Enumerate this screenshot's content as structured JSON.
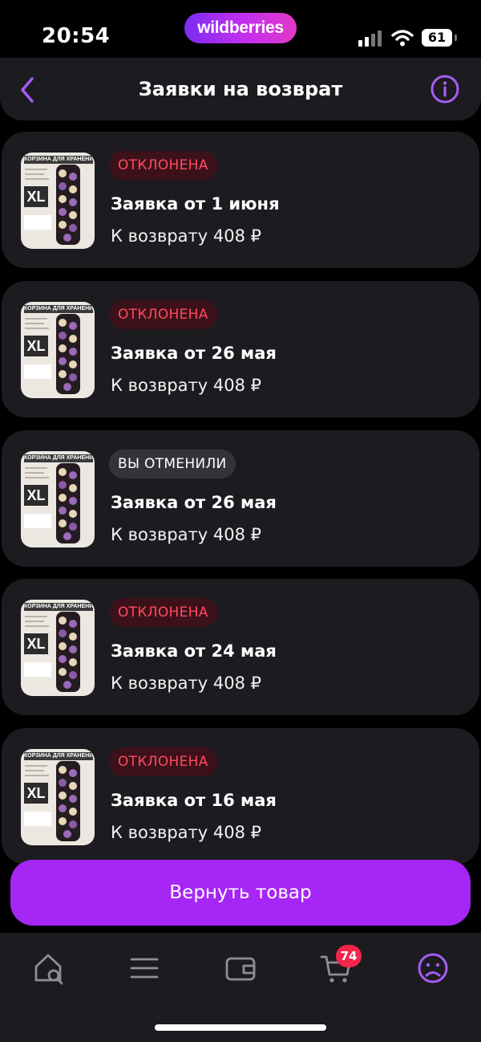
{
  "status_bar": {
    "time": "20:54",
    "brand": "wildberries",
    "battery": "61"
  },
  "header": {
    "title": "Заявки на возврат"
  },
  "requests": [
    {
      "status": "ОТКЛОНЕНА",
      "title": "Заявка от 1 июня",
      "refund": "К возврату 408 ₽"
    },
    {
      "status": "ОТКЛОНЕНА",
      "title": "Заявка от 26 мая",
      "refund": "К возврату 408 ₽"
    },
    {
      "status": "ВЫ ОТМЕНИЛИ",
      "title": "Заявка от 26 мая",
      "refund": "К возврату 408 ₽"
    },
    {
      "status": "ОТКЛОНЕНА",
      "title": "Заявка от 24 мая",
      "refund": "К возврату 408 ₽"
    },
    {
      "status": "ОТКЛОНЕНА",
      "title": "Заявка от 16 мая",
      "refund": "К возврату 408 ₽"
    }
  ],
  "product_image": {
    "banner": "КОРЗИНА ДЛЯ ХРАНЕНИЯ",
    "size": "XL"
  },
  "actions": {
    "return_label": "Вернуть товар"
  },
  "tabbar": {
    "items": [
      "home-search-icon",
      "catalog-menu-icon",
      "wallet-icon",
      "cart-icon",
      "profile-icon"
    ],
    "cart_badge": "74"
  },
  "colors": {
    "accent": "#a626f5",
    "card": "#1c1b20",
    "rejected_text": "#ff4b60",
    "rejected_bg": "#3d1119",
    "badge": "#f2264b"
  }
}
